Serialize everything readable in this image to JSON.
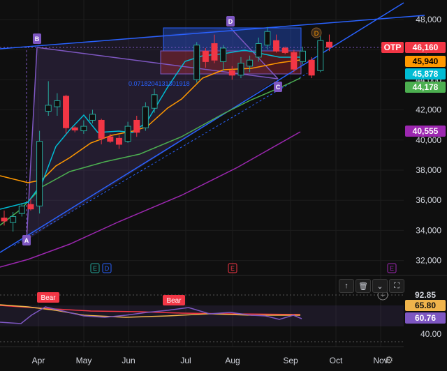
{
  "chart_data": {
    "type": "candlestick",
    "symbol": "OTP",
    "x_ticks": [
      "Apr",
      "May",
      "Jun",
      "Jul",
      "Aug",
      "Sep",
      "Oct",
      "Nov"
    ],
    "y_ticks": [
      "48,000",
      "46,000",
      "44,000",
      "42,000",
      "40,000",
      "38,000",
      "36,000",
      "34,000",
      "32,000"
    ],
    "ylim": [
      30700,
      48700
    ],
    "candles": [
      {
        "o": 34800,
        "h": 35300,
        "l": 34300,
        "c": 34600
      },
      {
        "o": 34500,
        "h": 35200,
        "l": 33900,
        "c": 34900
      },
      {
        "o": 35100,
        "h": 35800,
        "l": 34900,
        "c": 35600
      },
      {
        "o": 35700,
        "h": 36100,
        "l": 35300,
        "c": 35400
      },
      {
        "o": 35600,
        "h": 40600,
        "l": 35100,
        "c": 39900
      },
      {
        "o": 41900,
        "h": 43900,
        "l": 41600,
        "c": 42300
      },
      {
        "o": 42200,
        "h": 43100,
        "l": 41600,
        "c": 42600
      },
      {
        "o": 42900,
        "h": 43000,
        "l": 40400,
        "c": 40800
      },
      {
        "o": 40800,
        "h": 40900,
        "l": 40500,
        "c": 40650
      },
      {
        "o": 40600,
        "h": 41300,
        "l": 40400,
        "c": 40900
      },
      {
        "o": 41300,
        "h": 42000,
        "l": 41100,
        "c": 41700
      },
      {
        "o": 41300,
        "h": 41400,
        "l": 39700,
        "c": 40100
      },
      {
        "o": 40200,
        "h": 40400,
        "l": 39800,
        "c": 39900
      },
      {
        "o": 40100,
        "h": 40300,
        "l": 39400,
        "c": 39700
      },
      {
        "o": 39900,
        "h": 41200,
        "l": 39800,
        "c": 40900
      },
      {
        "o": 41300,
        "h": 41600,
        "l": 40200,
        "c": 40500
      },
      {
        "o": 40800,
        "h": 42500,
        "l": 40600,
        "c": 42200
      },
      {
        "o": 42100,
        "h": 43400,
        "l": 41800,
        "c": 43000
      },
      {
        "o": 44000,
        "h": 46500,
        "l": 43800,
        "c": 46300
      },
      {
        "o": 45900,
        "h": 46100,
        "l": 44800,
        "c": 45200
      },
      {
        "o": 46400,
        "h": 47000,
        "l": 45100,
        "c": 45300
      },
      {
        "o": 45200,
        "h": 46300,
        "l": 44600,
        "c": 46100
      },
      {
        "o": 44600,
        "h": 44900,
        "l": 44000,
        "c": 44300
      },
      {
        "o": 44300,
        "h": 45500,
        "l": 44100,
        "c": 45100
      },
      {
        "o": 44900,
        "h": 45600,
        "l": 44500,
        "c": 45300
      },
      {
        "o": 45500,
        "h": 46800,
        "l": 45200,
        "c": 46400
      },
      {
        "o": 46300,
        "h": 47500,
        "l": 46000,
        "c": 47200
      },
      {
        "o": 46600,
        "h": 47000,
        "l": 45800,
        "c": 45900
      },
      {
        "o": 46100,
        "h": 46200,
        "l": 45700,
        "c": 45800
      },
      {
        "o": 45800,
        "h": 46000,
        "l": 44500,
        "c": 44700
      },
      {
        "o": 45200,
        "h": 46200,
        "l": 45000,
        "c": 45900
      },
      {
        "o": 45300,
        "h": 45500,
        "l": 44100,
        "c": 44300
      },
      {
        "o": 44600,
        "h": 46900,
        "l": 44500,
        "c": 46600
      },
      {
        "o": 46500,
        "h": 47000,
        "l": 45900,
        "c": 46160
      }
    ],
    "price_badges": [
      {
        "label": "46,160",
        "color": "#f23645"
      },
      {
        "label": "45,940",
        "color": "#ff9800"
      },
      {
        "label": "45,878",
        "color": "#00bcd4"
      },
      {
        "label": "44,178",
        "color": "#4caf50"
      },
      {
        "label": "40,555",
        "color": "#9c27b0"
      }
    ],
    "pattern_points": [
      "A",
      "B",
      "C",
      "D"
    ],
    "pattern_ratio": "0.0718204131301918",
    "event_markers": [
      "E",
      "D",
      "E",
      "E"
    ],
    "oscillator": {
      "y_ticks": [
        "40.00"
      ],
      "badges": [
        {
          "label": "92.85",
          "color": "#0f0f0f",
          "text": "#d1d4dc"
        },
        {
          "label": "65.80",
          "color": "#f0b44c",
          "text": "#0f0f0f"
        },
        {
          "label": "60.76",
          "color": "#7e57c2",
          "text": "#ffffff"
        }
      ],
      "signals": [
        "Bear",
        "Bear"
      ]
    }
  },
  "symbol_label": "OTP",
  "toolbar": {
    "up": "↑",
    "delete": "🗑",
    "collapse": "⌄",
    "more": "⛶",
    "add": "+"
  },
  "corner_label": "⚙"
}
